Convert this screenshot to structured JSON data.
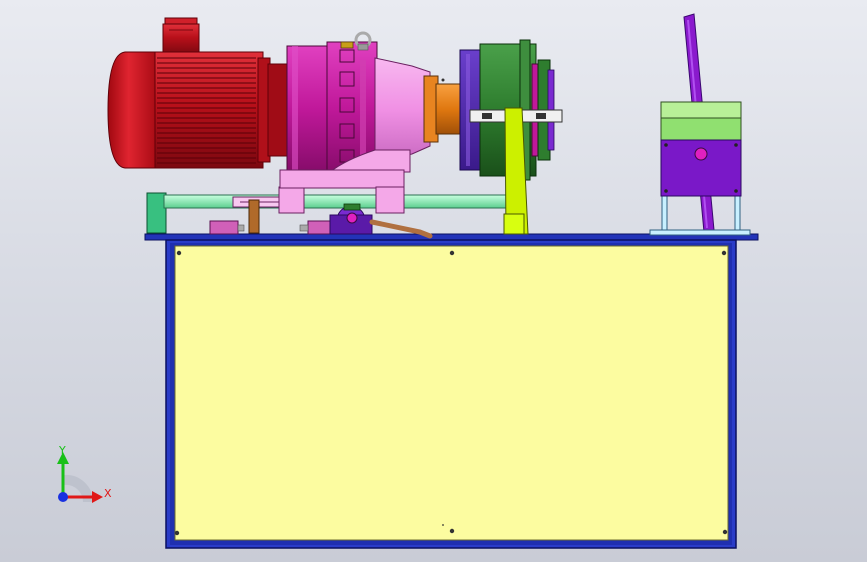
{
  "view": {
    "background": "#dde0e8"
  },
  "triad": {
    "x_label": "X",
    "y_label": "Y",
    "x_color": "#e01818",
    "y_color": "#18c018",
    "z_color": "#1830e0"
  },
  "parts": {
    "motor": {
      "color": "#c8141a",
      "icon": "electric-motor"
    },
    "reducer": {
      "color": "#c0189a",
      "icon": "cycloidal-reducer"
    },
    "coupling": {
      "color": "#e07810",
      "icon": "shaft-coupling"
    },
    "flange": {
      "color": "#2e7d2e",
      "icon": "flange-disc"
    },
    "support_arm": {
      "color": "#ccf000",
      "icon": "support-arm"
    },
    "valve_block": {
      "color": "#7a18c8",
      "icon": "valve-block"
    },
    "valve_top": {
      "color": "#90e070",
      "icon": "valve-top"
    },
    "lever": {
      "color": "#8a1acd",
      "icon": "hand-lever"
    },
    "base_rail": {
      "color": "#80e8a8",
      "icon": "guide-rail"
    },
    "tank_plate": {
      "color": "#fcfca0",
      "icon": "tank-plate"
    },
    "tank_frame": {
      "color": "#1f2fb0",
      "icon": "tank-frame"
    }
  }
}
